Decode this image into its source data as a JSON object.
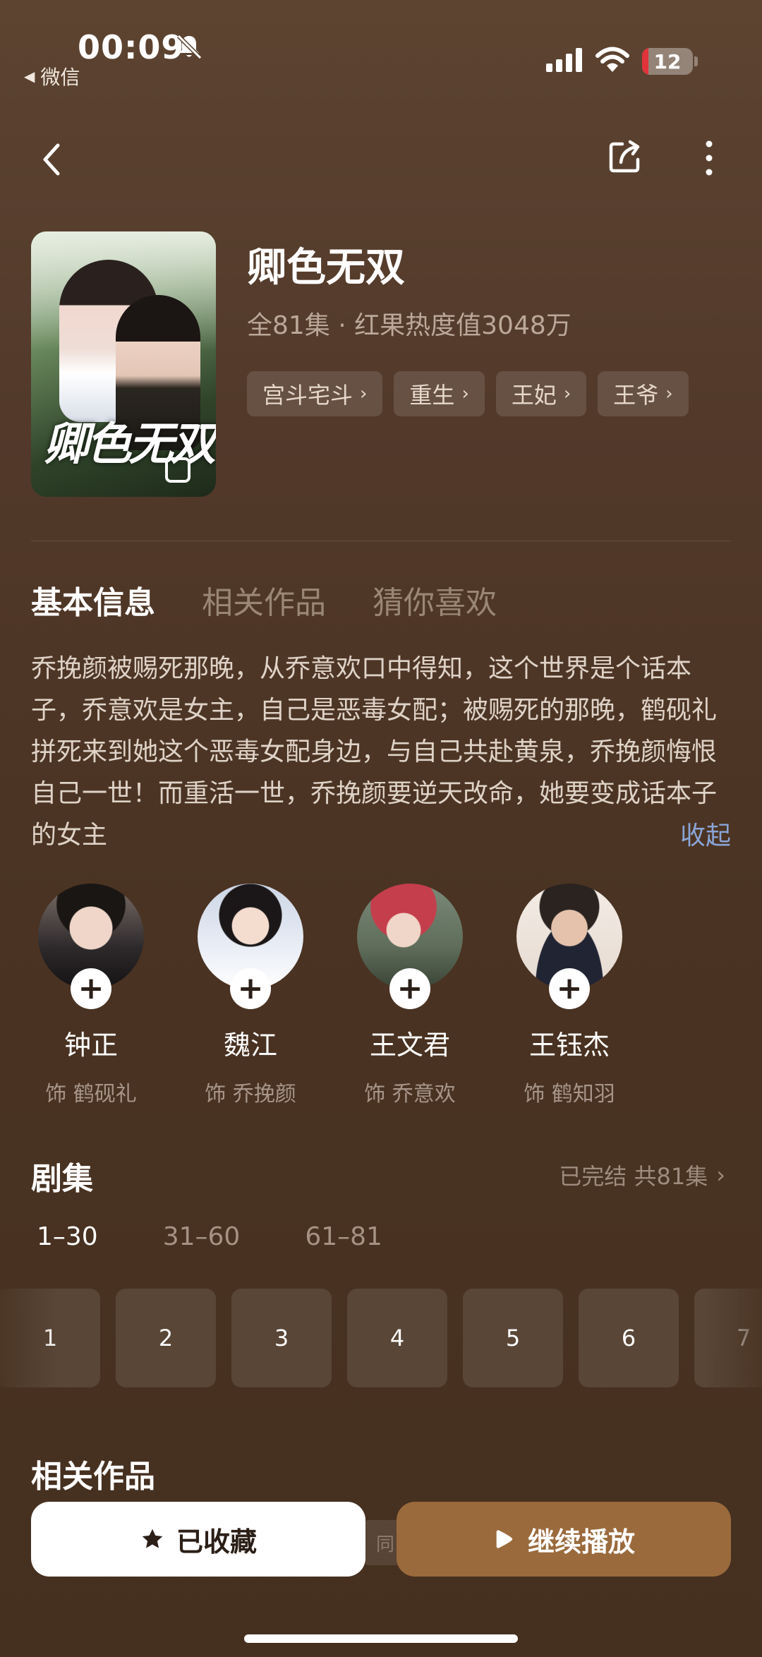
{
  "status_bar": {
    "time": "00:09",
    "back_app_label": "微信",
    "battery_level": 12,
    "battery_text": "12",
    "battery_color": "#e0333a"
  },
  "nav": {
    "back_icon": "chevron-left-icon",
    "share_icon": "share-icon",
    "more_icon": "more-vertical-icon"
  },
  "drama": {
    "title": "卿色无双",
    "poster_title": "卿色无双",
    "meta": "全81集 · 红果热度值3048万",
    "tags": [
      {
        "label": "宫斗宅斗"
      },
      {
        "label": "重生"
      },
      {
        "label": "王妃"
      },
      {
        "label": "王爷"
      }
    ]
  },
  "tabs": [
    {
      "label": "基本信息",
      "active": true
    },
    {
      "label": "相关作品",
      "active": false
    },
    {
      "label": "猜你喜欢",
      "active": false
    }
  ],
  "synopsis": {
    "text": "乔挽颜被赐死那晚，从乔意欢口中得知，这个世界是个话本子，乔意欢是女主，自己是恶毒女配；被赐死的那晚，鹤砚礼拼死来到她这个恶毒女配身边，与自己共赴黄泉，乔挽颜悔恨自己一世！而重活一世，乔挽颜要逆天改命，她要变成话本子的女主",
    "collapse_label": "收起"
  },
  "cast": [
    {
      "name": "钟正",
      "role": "饰 鹤砚礼"
    },
    {
      "name": "魏江",
      "role": "饰 乔挽颜"
    },
    {
      "name": "王文君",
      "role": "饰 乔意欢"
    },
    {
      "name": "王钰杰",
      "role": "饰 鹤知羽"
    }
  ],
  "episodes": {
    "title": "剧集",
    "status": "已完结 共81集",
    "ranges": [
      {
        "label": "1–30",
        "active": true
      },
      {
        "label": "31–60",
        "active": false
      },
      {
        "label": "61–81",
        "active": false
      }
    ],
    "items": [
      "1",
      "2",
      "3",
      "4",
      "5",
      "6",
      "7"
    ]
  },
  "related": {
    "title": "相关作品",
    "peek_text": "同"
  },
  "actions": {
    "favorite_label": "已收藏",
    "play_label": "继续播放",
    "favorite_icon": "star-icon",
    "play_icon": "play-icon",
    "play_color": "#9a6a3c"
  }
}
